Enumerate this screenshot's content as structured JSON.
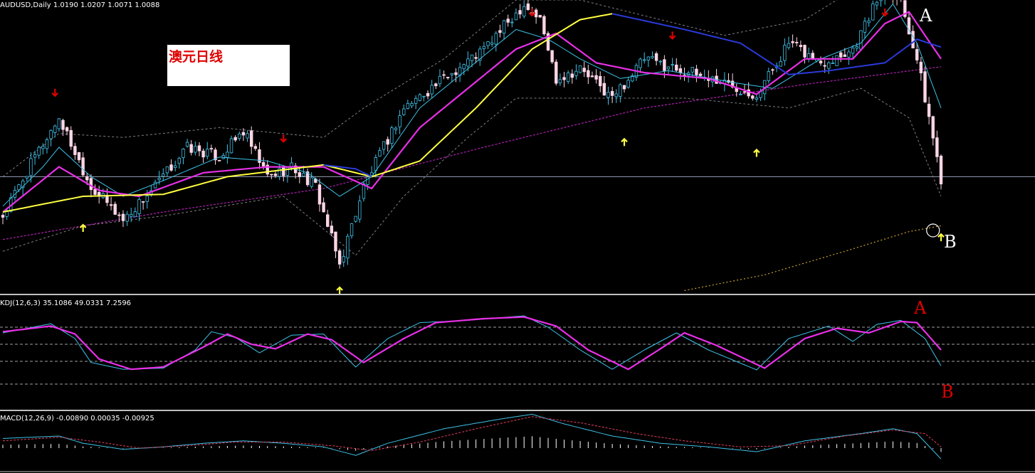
{
  "main_header": "AUDUSD,Daily  1.0190 1.0207 1.0071 1.0088",
  "kdj_header": "KDJ(12,6,3) 35.1086 49.0331 7.2596",
  "macd_header": "MACD(12,26,9) -0.00890 0.00035 -0.00925",
  "title_box_text": "澳元日线",
  "annotations": {
    "top_A": "A",
    "top_B": "B",
    "kdj_A": "A",
    "kdj_B": "B"
  },
  "colors": {
    "up_candle": "#3ec2e8",
    "down_candle": "#ffd6e6",
    "ma_fast": "#3ec2e8",
    "ma_mid": "#e830e8",
    "ma_slow_up": "#ffff40",
    "ma_slow_down": "#2a3ad8",
    "ma_long": "#b020b0",
    "ma_200": "#c8a030",
    "bands": "#808080",
    "arrow_up": "#ffff40",
    "arrow_down": "#e00000",
    "kdj_k": "#3ec2e8",
    "kdj_d": "#e830e8",
    "macd_line": "#3ec2e8",
    "macd_signal": "#e04060",
    "macd_hist": "#ffffff"
  },
  "chart_data": [
    {
      "type": "candlestick",
      "symbol": "AUDUSD",
      "timeframe": "Daily",
      "ylim": [
        0.95,
        1.1
      ],
      "price_path": [
        [
          0,
          0.99
        ],
        [
          8,
          1.02
        ],
        [
          14,
          1.04
        ],
        [
          22,
          1.005
        ],
        [
          30,
          0.988
        ],
        [
          38,
          1.005
        ],
        [
          46,
          1.025
        ],
        [
          54,
          1.02
        ],
        [
          60,
          1.033
        ],
        [
          66,
          1.01
        ],
        [
          72,
          1.015
        ],
        [
          78,
          1.005
        ],
        [
          84,
          0.965
        ],
        [
          90,
          1.005
        ],
        [
          100,
          1.045
        ],
        [
          110,
          1.06
        ],
        [
          120,
          1.075
        ],
        [
          130,
          1.098
        ],
        [
          134,
          1.09
        ],
        [
          138,
          1.06
        ],
        [
          144,
          1.065
        ],
        [
          152,
          1.05
        ],
        [
          160,
          1.07
        ],
        [
          170,
          1.064
        ],
        [
          180,
          1.058
        ],
        [
          188,
          1.052
        ],
        [
          196,
          1.078
        ],
        [
          204,
          1.068
        ],
        [
          212,
          1.075
        ],
        [
          220,
          1.108
        ],
        [
          224,
          1.1
        ],
        [
          228,
          1.07
        ],
        [
          232,
          1.03
        ],
        [
          234,
          1.009
        ]
      ],
      "ma_fast_path": [
        [
          0,
          0.995
        ],
        [
          10,
          1.015
        ],
        [
          14,
          1.025
        ],
        [
          22,
          1.01
        ],
        [
          30,
          1.0
        ],
        [
          40,
          1.008
        ],
        [
          54,
          1.02
        ],
        [
          66,
          1.018
        ],
        [
          76,
          1.012
        ],
        [
          84,
          1.0
        ],
        [
          92,
          1.01
        ],
        [
          104,
          1.045
        ],
        [
          116,
          1.065
        ],
        [
          128,
          1.085
        ],
        [
          136,
          1.08
        ],
        [
          144,
          1.07
        ],
        [
          154,
          1.06
        ],
        [
          166,
          1.064
        ],
        [
          182,
          1.058
        ],
        [
          192,
          1.055
        ],
        [
          204,
          1.07
        ],
        [
          214,
          1.078
        ],
        [
          222,
          1.098
        ],
        [
          228,
          1.078
        ],
        [
          234,
          1.045
        ]
      ],
      "ma_mid_path": [
        [
          0,
          0.992
        ],
        [
          14,
          1.015
        ],
        [
          24,
          1.003
        ],
        [
          34,
          1.0
        ],
        [
          50,
          1.012
        ],
        [
          66,
          1.015
        ],
        [
          80,
          1.015
        ],
        [
          92,
          1.004
        ],
        [
          104,
          1.035
        ],
        [
          116,
          1.055
        ],
        [
          128,
          1.075
        ],
        [
          138,
          1.083
        ],
        [
          148,
          1.068
        ],
        [
          160,
          1.063
        ],
        [
          176,
          1.06
        ],
        [
          188,
          1.052
        ],
        [
          200,
          1.07
        ],
        [
          212,
          1.07
        ],
        [
          220,
          1.088
        ],
        [
          226,
          1.094
        ],
        [
          234,
          1.07
        ]
      ],
      "ma_slow_path": [
        [
          0,
          0.992
        ],
        [
          20,
          1.0
        ],
        [
          40,
          1.001
        ],
        [
          56,
          1.01
        ],
        [
          80,
          1.016
        ],
        [
          92,
          1.01
        ],
        [
          104,
          1.018
        ],
        [
          118,
          1.045
        ],
        [
          132,
          1.075
        ],
        [
          144,
          1.09
        ],
        [
          152,
          1.093
        ]
      ],
      "ma_slow_down_path": [
        [
          152,
          1.093
        ],
        [
          170,
          1.085
        ],
        [
          184,
          1.078
        ],
        [
          196,
          1.062
        ],
        [
          206,
          1.064
        ],
        [
          220,
          1.068
        ],
        [
          228,
          1.08
        ],
        [
          234,
          1.076
        ]
      ],
      "ma_slow_down_early": [
        [
          80,
          1.016
        ],
        [
          88,
          1.014
        ],
        [
          92,
          1.01
        ]
      ],
      "ma_long_path": [
        [
          0,
          0.978
        ],
        [
          40,
          0.992
        ],
        [
          80,
          1.004
        ],
        [
          120,
          1.025
        ],
        [
          160,
          1.045
        ],
        [
          200,
          1.057
        ],
        [
          234,
          1.066
        ]
      ],
      "ma_200_path": [
        [
          170,
          0.952
        ],
        [
          190,
          0.96
        ],
        [
          210,
          0.972
        ],
        [
          226,
          0.982
        ],
        [
          234,
          0.985
        ]
      ],
      "band_upper_path": [
        [
          0,
          1.01
        ],
        [
          14,
          1.032
        ],
        [
          30,
          1.03
        ],
        [
          54,
          1.035
        ],
        [
          80,
          1.03
        ],
        [
          90,
          1.045
        ],
        [
          110,
          1.07
        ],
        [
          128,
          1.1
        ],
        [
          144,
          1.1
        ],
        [
          160,
          1.092
        ],
        [
          180,
          1.082
        ],
        [
          200,
          1.09
        ],
        [
          220,
          1.115
        ],
        [
          234,
          1.105
        ]
      ],
      "band_lower_path": [
        [
          0,
          0.972
        ],
        [
          20,
          0.985
        ],
        [
          40,
          0.99
        ],
        [
          70,
          1.0
        ],
        [
          88,
          0.97
        ],
        [
          100,
          1.0
        ],
        [
          116,
          1.03
        ],
        [
          128,
          1.05
        ],
        [
          144,
          1.05
        ],
        [
          170,
          1.05
        ],
        [
          196,
          1.045
        ],
        [
          214,
          1.055
        ],
        [
          226,
          1.04
        ],
        [
          234,
          1.0
        ]
      ],
      "horizontal_level": 1.01,
      "buy_arrows_x": [
        20,
        84,
        155,
        188,
        234
      ],
      "sell_arrows_x": [
        13,
        70,
        132,
        167,
        220
      ],
      "circle_x": 232
    },
    {
      "type": "line",
      "name": "KDJ",
      "ylim": [
        0,
        100
      ],
      "levels": [
        80,
        50,
        20,
        -10
      ],
      "k_path": [
        [
          0,
          70
        ],
        [
          12,
          86
        ],
        [
          18,
          60
        ],
        [
          22,
          18
        ],
        [
          30,
          6
        ],
        [
          40,
          8
        ],
        [
          48,
          40
        ],
        [
          52,
          72
        ],
        [
          58,
          62
        ],
        [
          64,
          35
        ],
        [
          72,
          66
        ],
        [
          80,
          68
        ],
        [
          88,
          10
        ],
        [
          96,
          60
        ],
        [
          104,
          88
        ],
        [
          116,
          92
        ],
        [
          130,
          100
        ],
        [
          136,
          80
        ],
        [
          144,
          40
        ],
        [
          152,
          6
        ],
        [
          160,
          40
        ],
        [
          168,
          70
        ],
        [
          176,
          40
        ],
        [
          188,
          5
        ],
        [
          196,
          60
        ],
        [
          206,
          82
        ],
        [
          212,
          55
        ],
        [
          218,
          85
        ],
        [
          224,
          92
        ],
        [
          230,
          60
        ],
        [
          234,
          12
        ]
      ],
      "d_path": [
        [
          0,
          72
        ],
        [
          12,
          82
        ],
        [
          18,
          68
        ],
        [
          24,
          24
        ],
        [
          32,
          6
        ],
        [
          40,
          10
        ],
        [
          50,
          45
        ],
        [
          56,
          68
        ],
        [
          62,
          50
        ],
        [
          68,
          42
        ],
        [
          76,
          68
        ],
        [
          82,
          58
        ],
        [
          90,
          18
        ],
        [
          100,
          60
        ],
        [
          108,
          88
        ],
        [
          120,
          95
        ],
        [
          130,
          98
        ],
        [
          138,
          82
        ],
        [
          146,
          40
        ],
        [
          156,
          6
        ],
        [
          164,
          42
        ],
        [
          170,
          70
        ],
        [
          178,
          48
        ],
        [
          190,
          8
        ],
        [
          200,
          60
        ],
        [
          208,
          78
        ],
        [
          216,
          70
        ],
        [
          224,
          90
        ],
        [
          228,
          88
        ],
        [
          234,
          40
        ]
      ]
    },
    {
      "type": "line",
      "name": "MACD",
      "ylim": [
        -0.02,
        0.03
      ],
      "macd_path": [
        [
          0,
          0.008
        ],
        [
          14,
          0.01
        ],
        [
          20,
          0.004
        ],
        [
          30,
          -0.001
        ],
        [
          40,
          0.001
        ],
        [
          50,
          0.004
        ],
        [
          60,
          0.006
        ],
        [
          70,
          0.004
        ],
        [
          80,
          0.001
        ],
        [
          88,
          -0.006
        ],
        [
          96,
          0.004
        ],
        [
          110,
          0.016
        ],
        [
          124,
          0.024
        ],
        [
          132,
          0.028
        ],
        [
          140,
          0.02
        ],
        [
          152,
          0.01
        ],
        [
          164,
          0.004
        ],
        [
          176,
          0.001
        ],
        [
          188,
          -0.003
        ],
        [
          200,
          0.006
        ],
        [
          214,
          0.012
        ],
        [
          222,
          0.016
        ],
        [
          228,
          0.012
        ],
        [
          234,
          -0.009
        ]
      ],
      "signal_path": [
        [
          0,
          0.006
        ],
        [
          14,
          0.009
        ],
        [
          24,
          0.005
        ],
        [
          34,
          0.0
        ],
        [
          46,
          0.002
        ],
        [
          58,
          0.005
        ],
        [
          70,
          0.005
        ],
        [
          82,
          0.002
        ],
        [
          92,
          -0.002
        ],
        [
          104,
          0.005
        ],
        [
          118,
          0.016
        ],
        [
          132,
          0.026
        ],
        [
          144,
          0.021
        ],
        [
          158,
          0.012
        ],
        [
          170,
          0.006
        ],
        [
          184,
          0.001
        ],
        [
          196,
          0.002
        ],
        [
          210,
          0.01
        ],
        [
          222,
          0.015
        ],
        [
          230,
          0.012
        ],
        [
          234,
          0.001
        ]
      ]
    }
  ]
}
